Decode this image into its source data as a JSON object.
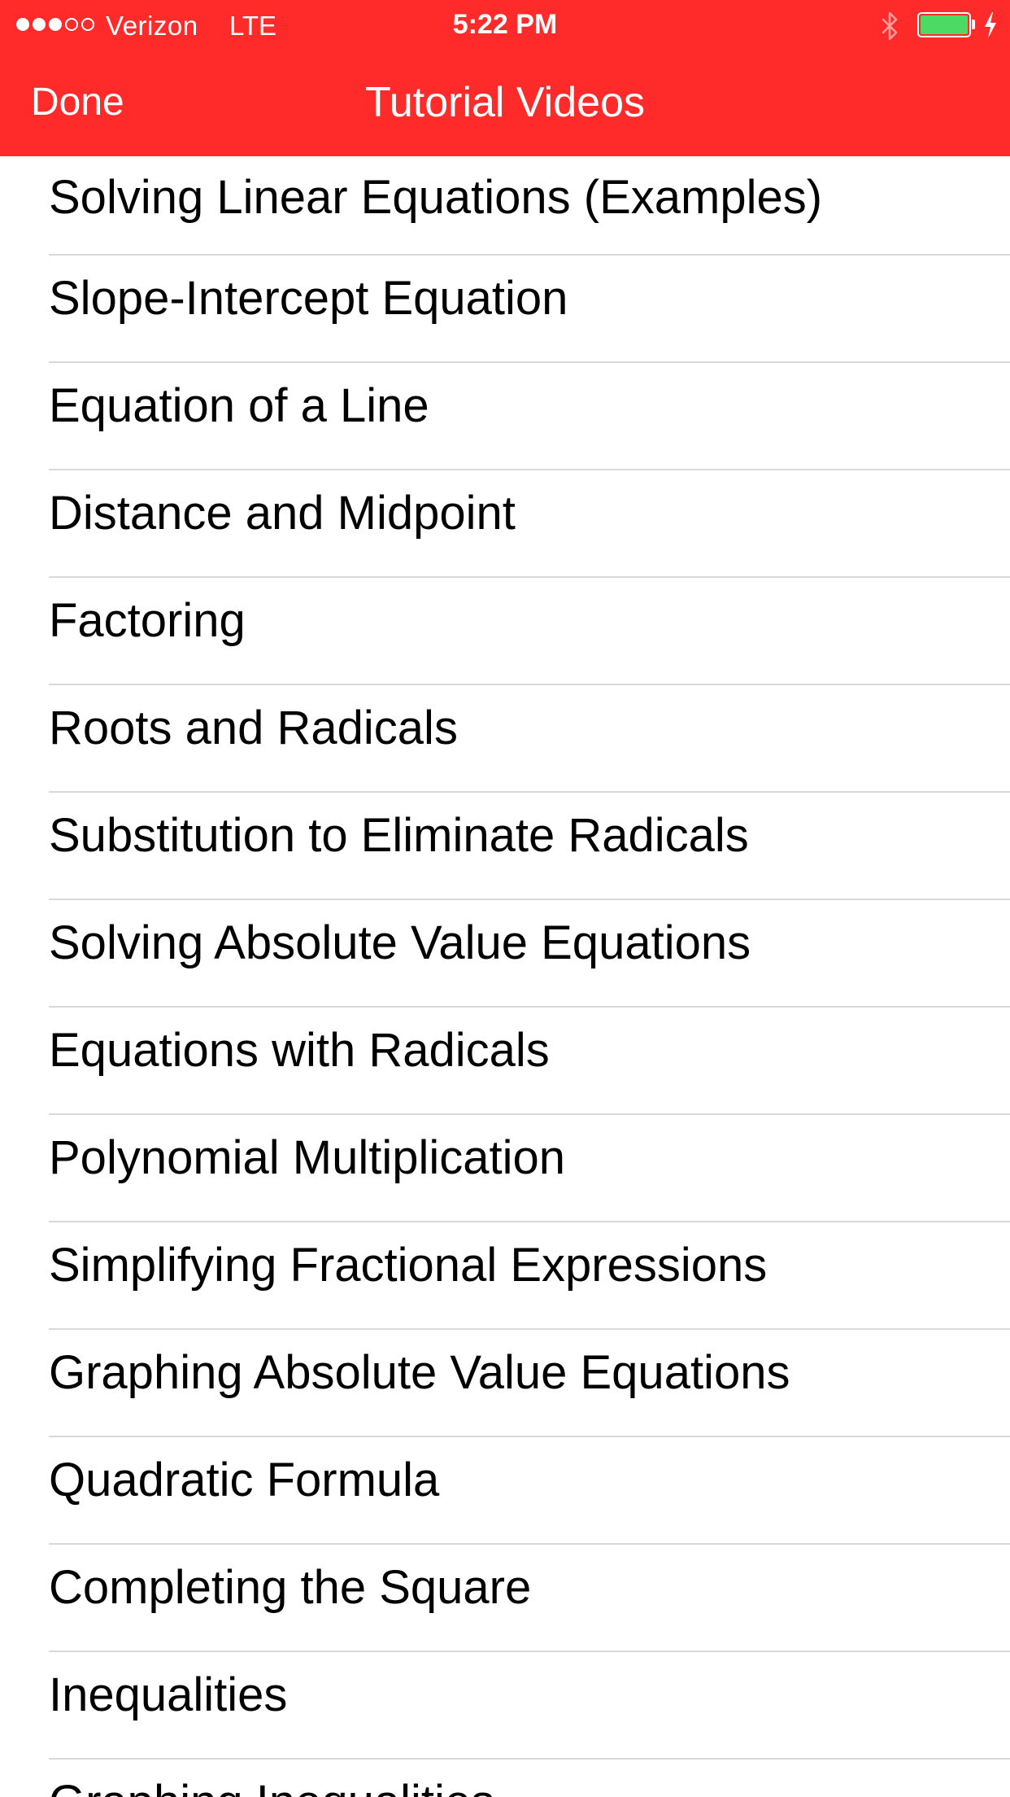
{
  "status_bar": {
    "carrier": "Verizon",
    "network": "LTE",
    "time": "5:22 PM",
    "signal_bars_filled": 3,
    "signal_bars_total": 5,
    "battery_level": 1.0,
    "battery_color": "#4cd964",
    "icons": [
      "bluetooth-icon",
      "battery-icon",
      "charging-icon"
    ]
  },
  "nav_bar": {
    "done_label": "Done",
    "title": "Tutorial Videos",
    "background_color": "#fe2b2a"
  },
  "list": {
    "items": [
      {
        "label": "Solving Linear Equations (Examples)"
      },
      {
        "label": "Slope-Intercept Equation"
      },
      {
        "label": "Equation of a Line"
      },
      {
        "label": "Distance and Midpoint"
      },
      {
        "label": "Factoring"
      },
      {
        "label": "Roots and Radicals"
      },
      {
        "label": "Substitution to Eliminate Radicals"
      },
      {
        "label": "Solving Absolute Value Equations"
      },
      {
        "label": "Equations with Radicals"
      },
      {
        "label": "Polynomial Multiplication"
      },
      {
        "label": "Simplifying Fractional Expressions"
      },
      {
        "label": "Graphing Absolute Value Equations"
      },
      {
        "label": "Quadratic Formula"
      },
      {
        "label": "Completing the Square"
      },
      {
        "label": "Inequalities"
      },
      {
        "label": "Graphing Inequalities"
      }
    ]
  }
}
